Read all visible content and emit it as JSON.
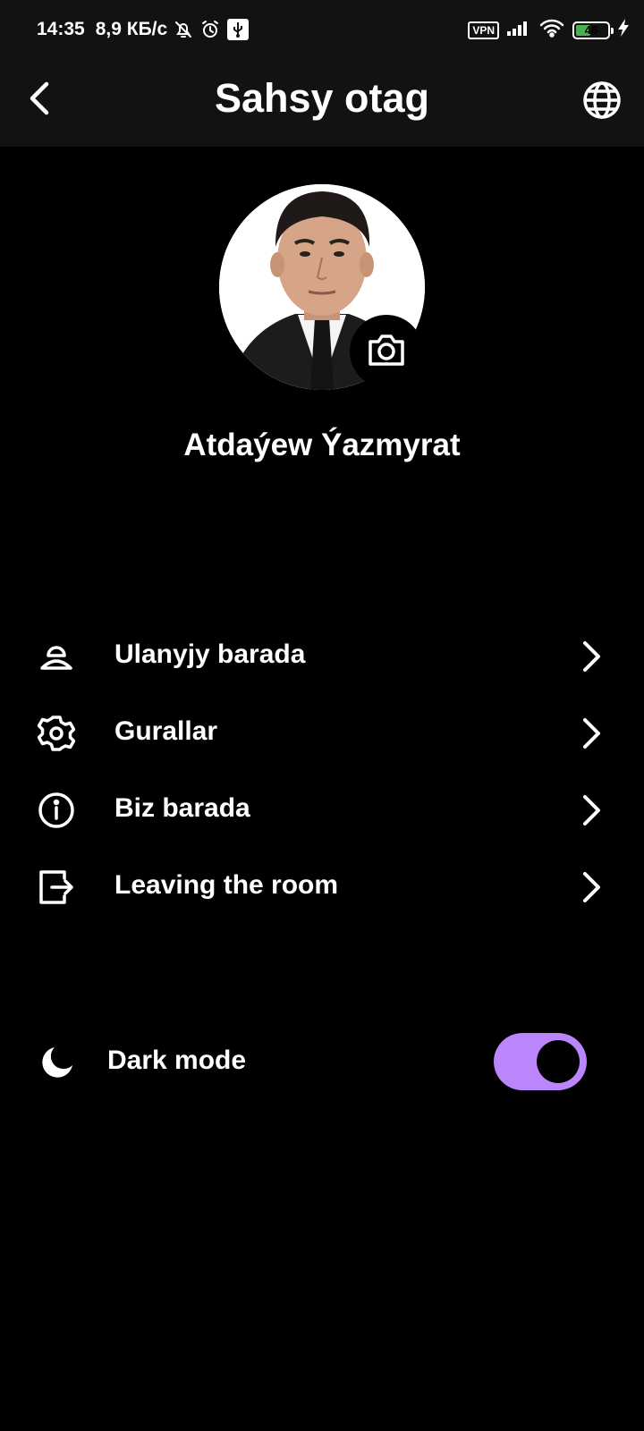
{
  "status_bar": {
    "time": "14:35",
    "speed": "8,9 КБ/с",
    "vpn": "VPN",
    "battery_level": "46",
    "battery_fraction": 0.46,
    "battery_color": "#4caf50",
    "icons": [
      "mute-icon",
      "alarm-icon",
      "usb-icon",
      "signal-icon",
      "wifi-icon",
      "charging-icon"
    ]
  },
  "header": {
    "title": "Sahsy otag",
    "back_icon": "chevron-left-icon",
    "language_icon": "globe-icon"
  },
  "profile": {
    "name": "Atdaýew Ýazmyrat",
    "camera_icon": "camera-icon"
  },
  "menu": [
    {
      "label": "Ulanyjy barada",
      "icon": "user-icon"
    },
    {
      "label": "Gurallar",
      "icon": "gear-icon"
    },
    {
      "label": "Biz barada",
      "icon": "info-icon"
    },
    {
      "label": "Leaving the room",
      "icon": "logout-icon"
    }
  ],
  "dark_mode": {
    "label": "Dark mode",
    "icon": "moon-icon",
    "enabled": true
  },
  "colors": {
    "background": "#000000",
    "header_background": "#121212",
    "accent": "#bb86fc",
    "text": "#ffffff"
  }
}
